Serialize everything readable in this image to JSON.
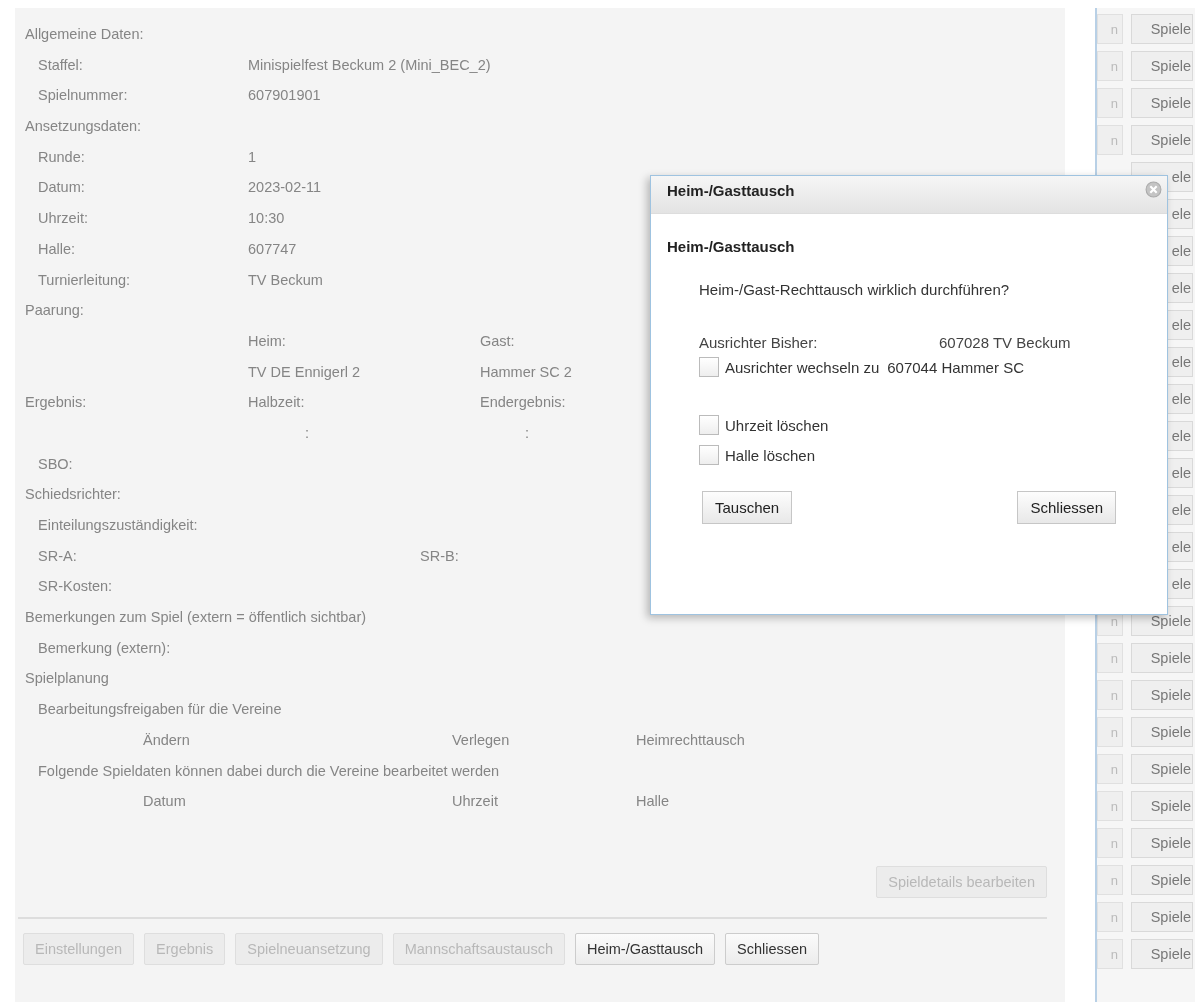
{
  "details": [
    {
      "kind": "heading",
      "cells": [
        "Allgemeine Daten:"
      ]
    },
    {
      "kind": "field",
      "cells": [
        "Staffel:",
        "Minispielfest Beckum 2 (Mini_BEC_2)"
      ]
    },
    {
      "kind": "field",
      "cells": [
        "Spielnummer:",
        "607901901"
      ]
    },
    {
      "kind": "heading",
      "cells": [
        "Ansetzungsdaten:"
      ]
    },
    {
      "kind": "field",
      "cells": [
        "Runde:",
        "1"
      ]
    },
    {
      "kind": "field",
      "cells": [
        "Datum:",
        "2023-02-11"
      ]
    },
    {
      "kind": "field",
      "cells": [
        "Uhrzeit:",
        "10:30"
      ]
    },
    {
      "kind": "field",
      "cells": [
        "Halle:",
        "607747"
      ]
    },
    {
      "kind": "field",
      "cells": [
        "Turnierleitung:",
        "TV Beckum"
      ]
    },
    {
      "kind": "heading",
      "cells": [
        "Paarung:"
      ]
    },
    {
      "kind": "field",
      "cells": [
        "",
        "Heim:",
        "Gast:"
      ]
    },
    {
      "kind": "field",
      "cells": [
        "",
        "TV DE Ennigerl 2",
        "Hammer SC 2"
      ]
    },
    {
      "kind": "heading",
      "cells": [
        "Ergebnis:",
        "Halbzeit:",
        "Endergebnis:"
      ]
    },
    {
      "kind": "score",
      "cells": [
        ":",
        ":"
      ]
    },
    {
      "kind": "field",
      "cells": [
        "SBO:"
      ]
    },
    {
      "kind": "heading",
      "cells": [
        "Schiedsrichter:"
      ]
    },
    {
      "kind": "field",
      "cells": [
        "Einteilungszuständigkeit:"
      ]
    },
    {
      "kind": "referee",
      "cells": [
        "SR-A:",
        "SR-B:"
      ]
    },
    {
      "kind": "field",
      "cells": [
        "SR-Kosten:"
      ]
    },
    {
      "kind": "heading",
      "cells": [
        "Bemerkungen zum Spiel (extern = öffentlich sichtbar)"
      ]
    },
    {
      "kind": "field",
      "cells": [
        "Bemerkung (extern):"
      ]
    },
    {
      "kind": "heading",
      "cells": [
        "Spielplanung"
      ]
    },
    {
      "kind": "field",
      "cells": [
        "Bearbeitungsfreigaben für die Vereine"
      ]
    },
    {
      "kind": "options",
      "cells": [
        "Ändern",
        "Verlegen",
        "Heimrechttausch"
      ]
    },
    {
      "kind": "field",
      "cells": [
        "Folgende Spieldaten können dabei durch die Vereine bearbeitet werden"
      ]
    },
    {
      "kind": "options",
      "cells": [
        "Datum",
        "Uhrzeit",
        "Halle"
      ]
    }
  ],
  "edit_button": {
    "label": "Spieldetails bearbeiten",
    "disabled": true
  },
  "footer_buttons": [
    {
      "label": "Einstellungen",
      "disabled": true
    },
    {
      "label": "Ergebnis",
      "disabled": true
    },
    {
      "label": "Spielneuansetzung",
      "disabled": true
    },
    {
      "label": "Mannschaftsaustausch",
      "disabled": true
    },
    {
      "label": "Heim-/Gasttausch",
      "disabled": false
    },
    {
      "label": "Schliessen",
      "disabled": false
    }
  ],
  "background_list": [
    {
      "stub": "n",
      "label": "Spiele"
    },
    {
      "stub": "n",
      "label": "Spiele"
    },
    {
      "stub": "n",
      "label": "Spiele"
    },
    {
      "stub": "n",
      "label": "Spiele"
    },
    {
      "label": "ele"
    },
    {
      "label": "ele"
    },
    {
      "label": "ele"
    },
    {
      "label": "ele"
    },
    {
      "label": "ele"
    },
    {
      "label": "ele"
    },
    {
      "label": "ele"
    },
    {
      "label": "ele"
    },
    {
      "label": "ele"
    },
    {
      "label": "ele"
    },
    {
      "label": "ele"
    },
    {
      "label": "ele"
    },
    {
      "stub": "n",
      "label": "Spiele"
    },
    {
      "stub": "n",
      "label": "Spiele"
    },
    {
      "stub": "n",
      "label": "Spiele"
    },
    {
      "stub": "n",
      "label": "Spiele"
    },
    {
      "stub": "n",
      "label": "Spiele"
    },
    {
      "stub": "n",
      "label": "Spiele"
    },
    {
      "stub": "n",
      "label": "Spiele"
    },
    {
      "stub": "n",
      "label": "Spiele"
    },
    {
      "stub": "n",
      "label": "Spiele"
    },
    {
      "stub": "n",
      "label": "Spiele"
    }
  ],
  "dialog": {
    "title": "Heim-/Gasttausch",
    "heading": "Heim-/Gasttausch",
    "question": "Heim-/Gast-Rechttausch wirklich durchführen?",
    "current_host": {
      "label": "Ausrichter Bisher:",
      "value": "607028 TV Beckum"
    },
    "options": [
      {
        "kind": "host",
        "label": "Ausrichter wechseln zu",
        "value": "607044 Hammer SC",
        "checked": false
      },
      {
        "kind": "plain",
        "label": "Uhrzeit löschen",
        "checked": false
      },
      {
        "kind": "plain",
        "label": "Halle löschen",
        "checked": false
      }
    ],
    "buttons": [
      "Tauschen",
      "Schliessen"
    ]
  }
}
